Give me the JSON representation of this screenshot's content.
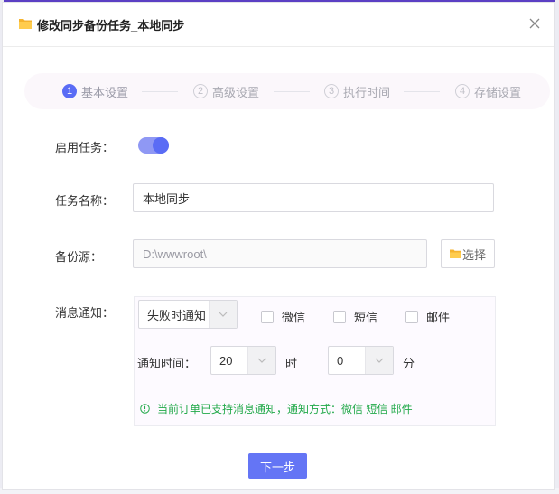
{
  "dialog": {
    "title": "修改同步备份任务_本地同步"
  },
  "steps": [
    {
      "num": "1",
      "label": "基本设置"
    },
    {
      "num": "2",
      "label": "高级设置"
    },
    {
      "num": "3",
      "label": "执行时间"
    },
    {
      "num": "4",
      "label": "存储设置"
    }
  ],
  "form": {
    "enable_label": "启用任务：",
    "enable_on": true,
    "name_label": "任务名称：",
    "name_value": "本地同步",
    "source_label": "备份源：",
    "source_value": "D:\\wwwroot\\",
    "select_button": "选择",
    "notify_label": "消息通知：",
    "notify_mode": "失败时通知",
    "channels": [
      {
        "label": "微信",
        "checked": false
      },
      {
        "label": "短信",
        "checked": false
      },
      {
        "label": "邮件",
        "checked": false
      }
    ],
    "notify_time_label": "通知时间：",
    "hour_value": "20",
    "hour_unit": "时",
    "minute_value": "0",
    "minute_unit": "分",
    "hint": "当前订单已支持消息通知，通知方式：微信 短信 邮件"
  },
  "footer": {
    "next_label": "下一步"
  },
  "colors": {
    "accent": "#5a6cf5",
    "hint_green": "#22a94a",
    "folder": "#f5b32e"
  }
}
